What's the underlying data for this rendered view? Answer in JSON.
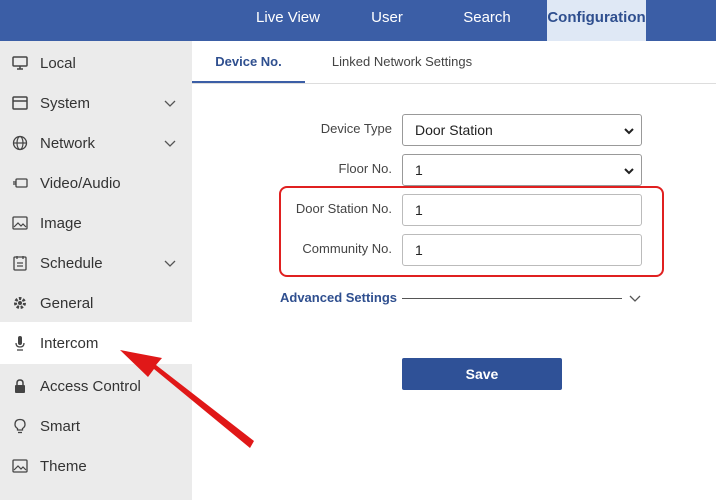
{
  "topnav": {
    "items": [
      {
        "label": "Live View"
      },
      {
        "label": "User"
      },
      {
        "label": "Search"
      },
      {
        "label": "Configuration"
      }
    ]
  },
  "sidebar": {
    "items": [
      {
        "label": "Local",
        "icon": "monitor-icon"
      },
      {
        "label": "System",
        "icon": "system-icon"
      },
      {
        "label": "Network",
        "icon": "globe-icon"
      },
      {
        "label": "Video/Audio",
        "icon": "video-icon"
      },
      {
        "label": "Image",
        "icon": "image-icon"
      },
      {
        "label": "Schedule",
        "icon": "schedule-icon"
      },
      {
        "label": "General",
        "icon": "gear-icon"
      },
      {
        "label": "Intercom",
        "icon": "microphone-icon"
      },
      {
        "label": "Access Control",
        "icon": "lock-icon"
      },
      {
        "label": "Smart",
        "icon": "bulb-icon"
      },
      {
        "label": "Theme",
        "icon": "theme-icon"
      }
    ]
  },
  "tabs": [
    {
      "label": "Device No."
    },
    {
      "label": "Linked Network Settings"
    }
  ],
  "form": {
    "device_type": {
      "label": "Device Type",
      "value": "Door Station"
    },
    "floor_no": {
      "label": "Floor No.",
      "value": "1"
    },
    "door_station_no": {
      "label": "Door Station No.",
      "value": "1"
    },
    "community_no": {
      "label": "Community No.",
      "value": "1"
    }
  },
  "advanced": {
    "label": "Advanced Settings"
  },
  "save": {
    "label": "Save"
  },
  "colors": {
    "accent": "#3b5ea6",
    "highlight": "#e02020",
    "button": "#2f5197"
  }
}
